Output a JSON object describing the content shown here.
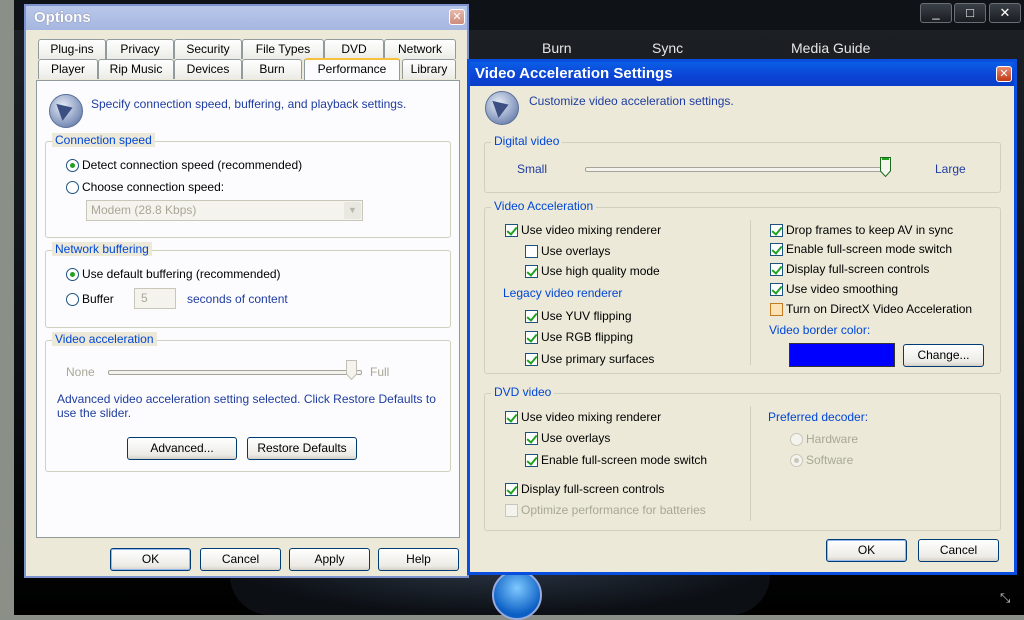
{
  "player": {
    "tabs": [
      "Burn",
      "Sync",
      "Media Guide"
    ],
    "window_buttons": [
      "_",
      "□",
      "✕"
    ]
  },
  "options": {
    "title": "Options",
    "tabs_row1": [
      "Plug-ins",
      "Privacy",
      "Security",
      "File Types",
      "DVD",
      "Network"
    ],
    "tabs_row2": [
      "Player",
      "Rip Music",
      "Devices",
      "Burn",
      "Performance",
      "Library"
    ],
    "selected_tab": "Performance",
    "header_text": "Specify connection speed, buffering, and playback settings.",
    "connection": {
      "legend": "Connection speed",
      "detect_label": "Detect connection speed (recommended)",
      "choose_label": "Choose connection speed:",
      "speed_value": "Modem (28.8 Kbps)"
    },
    "buffering": {
      "legend": "Network buffering",
      "default_label": "Use default buffering (recommended)",
      "buffer_label": "Buffer",
      "buffer_value": "5",
      "seconds_label": "seconds of content"
    },
    "video_accel": {
      "legend": "Video acceleration",
      "none_label": "None",
      "full_label": "Full",
      "level_fraction": 1.0,
      "note": "Advanced video acceleration setting selected. Click Restore Defaults to use the slider.",
      "advanced_button": "Advanced...",
      "restore_button": "Restore Defaults"
    },
    "buttons": {
      "ok": "OK",
      "cancel": "Cancel",
      "apply": "Apply",
      "help": "Help"
    }
  },
  "vas": {
    "title": "Video Acceleration Settings",
    "header_text": "Customize video acceleration settings.",
    "digital_video": {
      "legend": "Digital video",
      "small_label": "Small",
      "large_label": "Large",
      "level_fraction": 1.0
    },
    "video_acceleration": {
      "legend": "Video Acceleration",
      "use_vmr": "Use video mixing renderer",
      "use_overlays": "Use overlays",
      "use_hq_mode": "Use high quality mode",
      "legacy_label": "Legacy video renderer",
      "use_yuv": "Use YUV flipping",
      "use_rgb": "Use RGB flipping",
      "use_primary": "Use primary surfaces",
      "drop_frames": "Drop frames to keep AV in sync",
      "fullscreen_switch": "Enable full-screen mode switch",
      "fullscreen_controls": "Display full-screen controls",
      "smoothing": "Use video smoothing",
      "directx": "Turn on DirectX Video Acceleration",
      "border_color_label": "Video border color:",
      "border_color": "#0000ff",
      "change_button": "Change..."
    },
    "dvd_video": {
      "legend": "DVD video",
      "use_vmr": "Use video mixing renderer",
      "use_overlays": "Use overlays",
      "fullscreen_switch": "Enable full-screen mode switch",
      "fullscreen_controls": "Display full-screen controls",
      "optimize_batteries": "Optimize performance for batteries",
      "preferred_decoder_label": "Preferred decoder:",
      "hardware": "Hardware",
      "software": "Software"
    },
    "buttons": {
      "ok": "OK",
      "cancel": "Cancel"
    }
  },
  "colors": {
    "accent_blue": "#0046d5",
    "title_blue": "#0b43d5",
    "checkmark_green": "#21a121"
  }
}
